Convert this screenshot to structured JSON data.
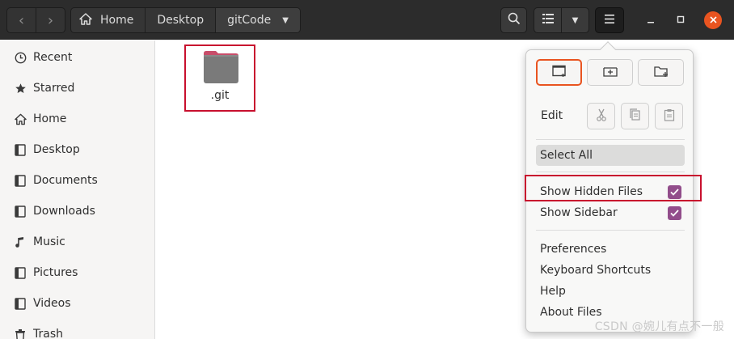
{
  "header": {
    "path": [
      "Home",
      "Desktop",
      "gitCode"
    ],
    "back_icon": "chevron-left-icon",
    "forward_icon": "chevron-right-icon",
    "home_icon": "home-icon"
  },
  "sidebar": {
    "items": [
      {
        "label": "Recent",
        "icon": "clock-icon"
      },
      {
        "label": "Starred",
        "icon": "star-icon"
      },
      {
        "label": "Home",
        "icon": "home-icon"
      },
      {
        "label": "Desktop",
        "icon": "desktop-icon"
      },
      {
        "label": "Documents",
        "icon": "document-icon"
      },
      {
        "label": "Downloads",
        "icon": "download-icon"
      },
      {
        "label": "Music",
        "icon": "music-icon"
      },
      {
        "label": "Pictures",
        "icon": "picture-icon"
      },
      {
        "label": "Videos",
        "icon": "video-icon"
      },
      {
        "label": "Trash",
        "icon": "trash-icon"
      }
    ]
  },
  "files": [
    {
      "name": ".git",
      "icon": "folder-icon"
    }
  ],
  "menu": {
    "edit_label": "Edit",
    "select_all": "Select All",
    "show_hidden_files": "Show Hidden Files",
    "show_sidebar": "Show Sidebar",
    "preferences": "Preferences",
    "keyboard_shortcuts": "Keyboard Shortcuts",
    "help": "Help",
    "about_files": "About Files",
    "show_hidden_checked": true,
    "show_sidebar_checked": true
  },
  "watermark": "CSDN @婉儿有点不一般",
  "colors": {
    "accent": "#e95420",
    "check": "#924d8b",
    "annotation": "#c8102e",
    "folder": "#7a7a7a",
    "folder_tab": "#c84d6a"
  }
}
